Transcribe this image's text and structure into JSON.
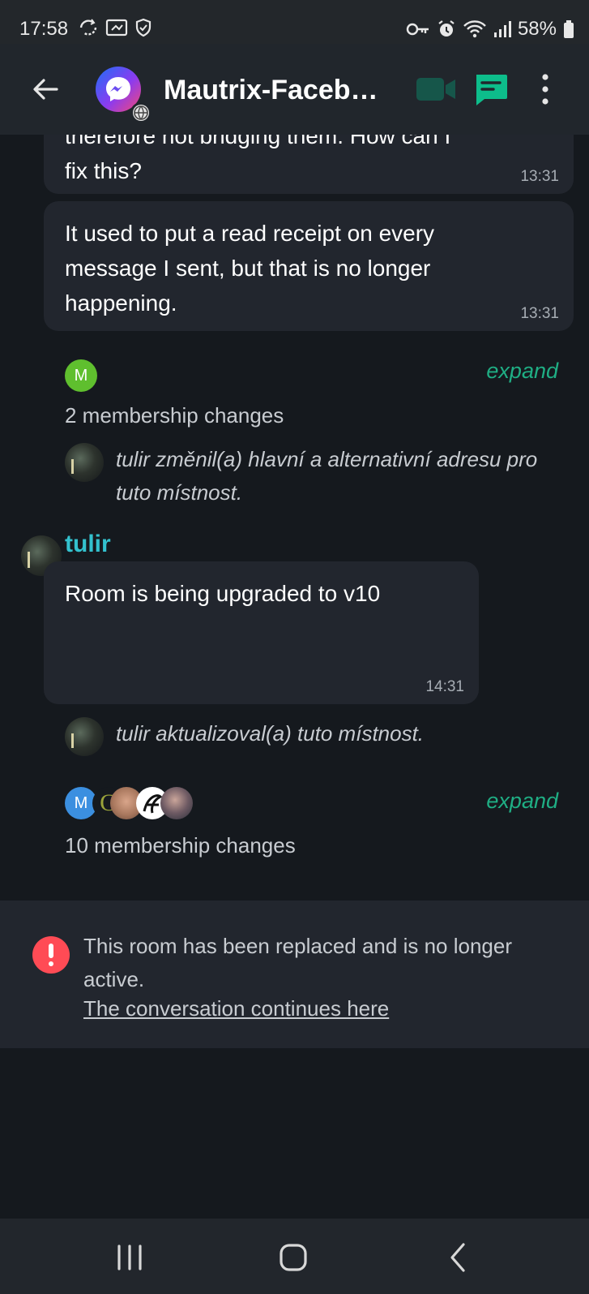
{
  "status_bar": {
    "time": "17:58",
    "battery": "58%",
    "icons": [
      "sync-icon",
      "cast-icon",
      "shield-icon",
      "key-icon",
      "alarm-icon",
      "wifi-icon",
      "signal-icon",
      "battery-icon"
    ]
  },
  "header": {
    "title": "Mautrix-Facebo…",
    "avatar_icon": "messenger-icon",
    "badge_icon": "globe-icon",
    "back_icon": "arrow-left-icon",
    "video_icon": "video-call-icon",
    "threads_icon": "threads-icon",
    "menu_icon": "overflow-menu-icon",
    "accent_color": "#0dbd8b"
  },
  "messages": [
    {
      "partial_line": "therefore not bridging them. How can I",
      "last_line": "fix this?",
      "time": "13:31"
    },
    {
      "text": "It used to put a read receipt on every message I sent, but that is no longer happening.",
      "time": "13:31"
    }
  ],
  "membership_group_1": {
    "avatar_letter": "M",
    "avatar_color": "#5fbf2e",
    "expand_label": "expand",
    "summary": "2 membership changes"
  },
  "event_1": {
    "text": "tulir změnil(a) hlavní a alternativní adresu pro tuto místnost."
  },
  "sender": {
    "name": "tulir",
    "name_color": "#33c1ce",
    "message": "Room is being upgraded to v10",
    "time": "14:31"
  },
  "event_2": {
    "text": "tulir aktualizoval(a) tuto místnost."
  },
  "membership_group_2": {
    "avatar_letters": [
      "M",
      "G"
    ],
    "expand_label": "expand",
    "summary": "10 membership changes"
  },
  "replaced_notice": {
    "message": "This room has been replaced and is no longer active.",
    "link": "The conversation continues here",
    "icon_color": "#ff4b55"
  },
  "nav_bar": {
    "icons": [
      "recent-apps-icon",
      "home-icon",
      "back-icon"
    ]
  }
}
